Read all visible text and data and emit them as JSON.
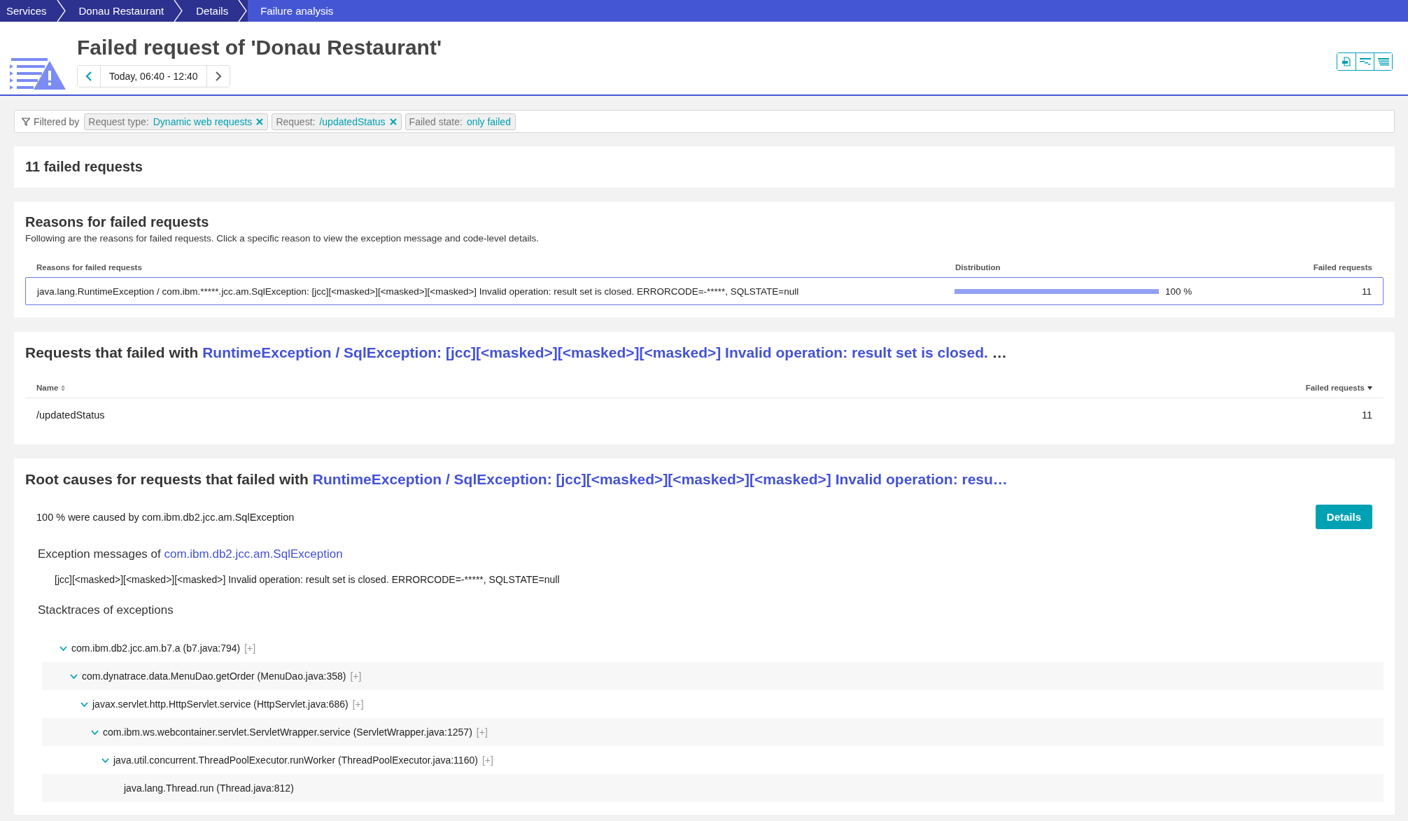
{
  "breadcrumb": [
    {
      "label": "Services",
      "selected": false
    },
    {
      "label": "Donau Restaurant",
      "selected": false
    },
    {
      "label": "Details",
      "selected": false
    },
    {
      "label": "Failure analysis",
      "selected": true
    }
  ],
  "header": {
    "title": "Failed request of 'Donau Restaurant'",
    "timeframe": "Today, 06:40 - 12:40"
  },
  "filter_bar": {
    "label": "Filtered by",
    "chips": [
      {
        "key": "Request type:",
        "value": "Dynamic web requests",
        "removable": true
      },
      {
        "key": "Request:",
        "value": "/updatedStatus",
        "removable": true
      },
      {
        "key": "Failed state:",
        "value": "only failed",
        "removable": false
      }
    ]
  },
  "summary": {
    "title": "11 failed requests"
  },
  "reasons": {
    "title": "Reasons for failed requests",
    "description": "Following are the reasons for failed requests. Click a specific reason to view the exception message and code-level details.",
    "columns": [
      "Reasons for failed requests",
      "Distribution",
      "Failed requests"
    ],
    "rows": [
      {
        "reason": "java.lang.RuntimeException / com.ibm.*****.jcc.am.SqlException: [jcc][<masked>][<masked>][<masked>] Invalid operation: result set is closed. ERRORCODE=-*****, SQLSTATE=null",
        "level": 1.0,
        "percent": "100 %",
        "count": "11",
        "selected": true
      }
    ]
  },
  "requests": {
    "title_prefix": "Requests that failed with ",
    "title_link": "RuntimeException / SqlException: [jcc][<masked>][<masked>][<masked>] Invalid operation: result set is closed.",
    "title_suffix": "…",
    "columns": [
      {
        "label": "Name",
        "sorted": false
      },
      {
        "label": "Failed requests",
        "sorted": true
      }
    ],
    "rows": [
      {
        "name": "/updatedStatus",
        "count": "11"
      }
    ]
  },
  "root_causes": {
    "title_prefix": "Root causes for requests that failed with ",
    "title_link": "RuntimeException / SqlException: [jcc][<masked>][<masked>][<masked>] Invalid operation: resu…",
    "caused_by": "100 % were caused by com.ibm.db2.jcc.am.SqlException",
    "details_button": "Details",
    "messages_prefix": "Exception messages of ",
    "messages_link": "com.ibm.db2.jcc.am.SqlException",
    "message": "[jcc][<masked>][<masked>][<masked>] Invalid operation: result set is closed. ERRORCODE=-*****, SQLSTATE=null",
    "stacktraces_title": "Stacktraces of exceptions",
    "stacktrace": [
      {
        "frame": "com.ibm.db2.jcc.am.b7.a (b7.java:794)",
        "expand": "[+]",
        "expanded": true,
        "children": [
          {
            "frame": "com.dynatrace.data.MenuDao.getOrder (MenuDao.java:358)",
            "expand": "[+]",
            "expanded": true,
            "children": [
              {
                "frame": "javax.servlet.http.HttpServlet.service (HttpServlet.java:686)",
                "expand": "[+]",
                "expanded": true,
                "children": [
                  {
                    "frame": "com.ibm.ws.webcontainer.servlet.ServletWrapper.service (ServletWrapper.java:1257)",
                    "expand": "[+]",
                    "expanded": true,
                    "children": [
                      {
                        "frame": "java.util.concurrent.ThreadPoolExecutor.runWorker (ThreadPoolExecutor.java:1160)",
                        "expand": "[+]",
                        "expanded": true,
                        "children": [
                          {
                            "frame": "java.lang.Thread.run (Thread.java:812)"
                          }
                        ]
                      }
                    ]
                  }
                ]
              }
            ]
          }
        ]
      }
    ]
  }
}
